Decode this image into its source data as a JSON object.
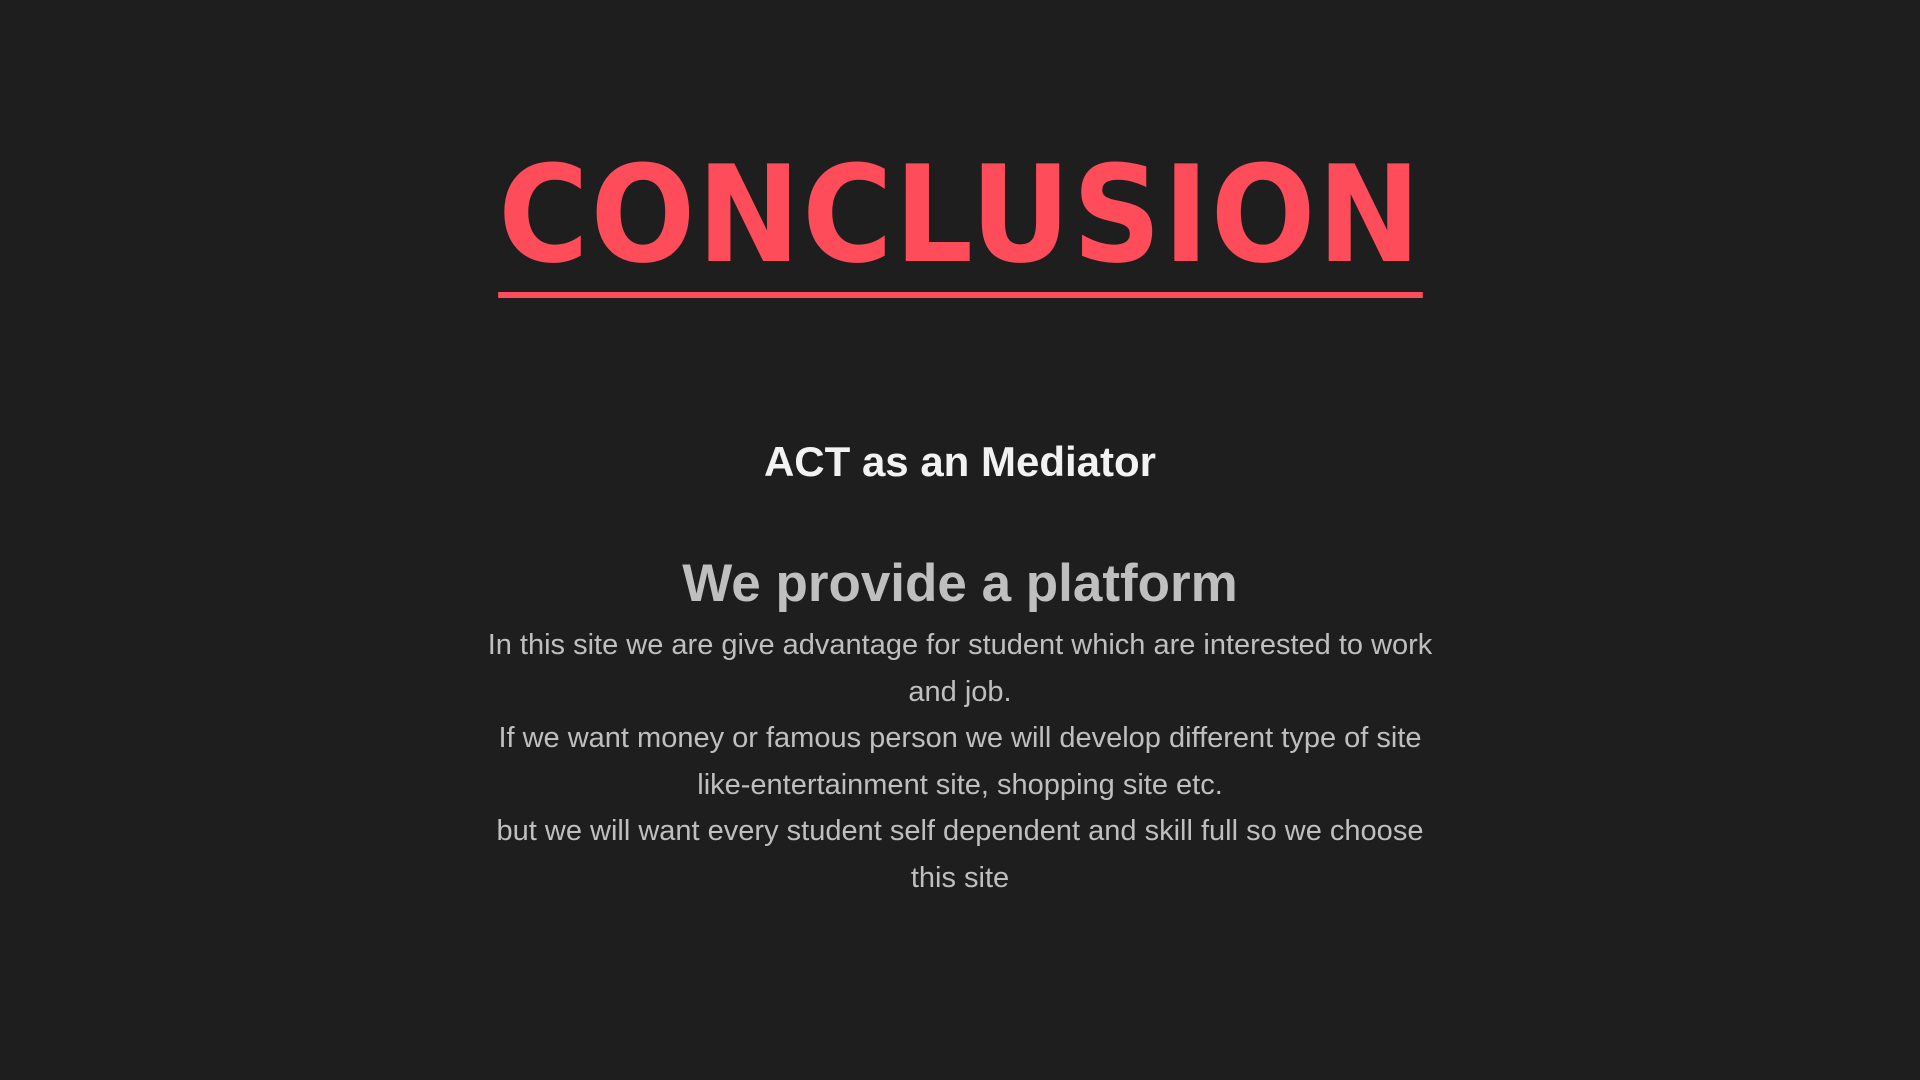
{
  "slide": {
    "title": "CONCLUSION",
    "subtitle": "ACT as an Mediator",
    "heading": "We provide a platform",
    "paragraphs": [
      "In this site we are give advantage for student which are interested to work and job.",
      "If we want money or famous person we will develop different type of site like-entertainment site, shopping site etc.",
      "but  we will want every student self dependent and skill full so we choose this site"
    ]
  },
  "colors": {
    "background": "#1e1e1e",
    "title": "#ff4c5b",
    "subtitle": "#f2f2f2",
    "heading": "#bfbfbf",
    "body": "#bfbfbf"
  }
}
